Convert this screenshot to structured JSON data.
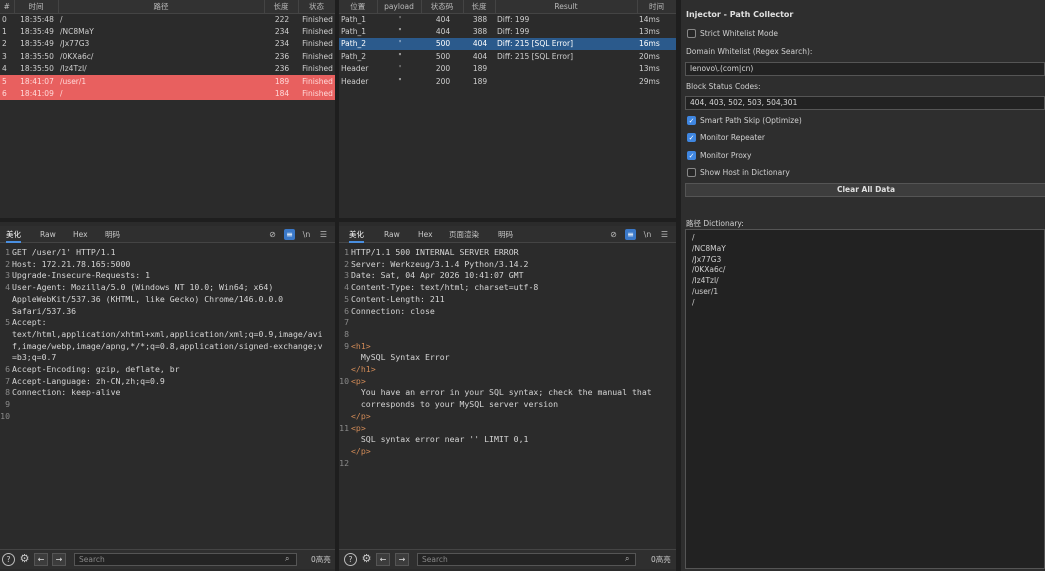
{
  "left_table": {
    "headers": [
      "#",
      "时间",
      "路径",
      "长度",
      "状态"
    ],
    "rows": [
      {
        "id": "0",
        "time": "18:35:48",
        "path": "/",
        "length": "222",
        "status": "Finished",
        "style": "normal"
      },
      {
        "id": "1",
        "time": "18:35:49",
        "path": "/NC8MaY",
        "length": "234",
        "status": "Finished",
        "style": "normal"
      },
      {
        "id": "2",
        "time": "18:35:49",
        "path": "/Jx77G3",
        "length": "234",
        "status": "Finished",
        "style": "normal"
      },
      {
        "id": "3",
        "time": "18:35:50",
        "path": "/0KXa6c/",
        "length": "236",
        "status": "Finished",
        "style": "normal"
      },
      {
        "id": "4",
        "time": "18:35:50",
        "path": "/Iz4TzI/",
        "length": "236",
        "status": "Finished",
        "style": "normal"
      },
      {
        "id": "5",
        "time": "18:41:07",
        "path": "/user/1",
        "length": "189",
        "status": "Finished",
        "style": "red"
      },
      {
        "id": "6",
        "time": "18:41:09",
        "path": "/",
        "length": "184",
        "status": "Finished",
        "style": "red"
      }
    ]
  },
  "mid_table": {
    "headers": [
      "位置",
      "payload",
      "状态码",
      "长度",
      "Result",
      "时间"
    ],
    "rows": [
      {
        "pos": "Path_1",
        "payload": "'",
        "code": "404",
        "length": "388",
        "result": "Diff: 199",
        "time": "14ms",
        "style": "normal"
      },
      {
        "pos": "Path_1",
        "payload": "\"",
        "code": "404",
        "length": "388",
        "result": "Diff: 199",
        "time": "13ms",
        "style": "normal"
      },
      {
        "pos": "Path_2",
        "payload": "'",
        "code": "500",
        "length": "404",
        "result": "Diff: 215 [SQL Error]",
        "time": "16ms",
        "style": "selected"
      },
      {
        "pos": "Path_2",
        "payload": "\"",
        "code": "500",
        "length": "404",
        "result": "Diff: 215 [SQL Error]",
        "time": "20ms",
        "style": "normal"
      },
      {
        "pos": "Header",
        "payload": "'",
        "code": "200",
        "length": "189",
        "result": "",
        "time": "13ms",
        "style": "normal"
      },
      {
        "pos": "Header",
        "payload": "\"",
        "code": "200",
        "length": "189",
        "result": "",
        "time": "29ms",
        "style": "normal"
      }
    ]
  },
  "request_editor": {
    "tabs": [
      "美化",
      "Raw",
      "Hex",
      "明码"
    ],
    "lines": [
      {
        "n": "1",
        "t": "GET /user/1' HTTP/1.1"
      },
      {
        "n": "2",
        "t": "Host: 172.21.78.165:5000"
      },
      {
        "n": "3",
        "t": "Upgrade-Insecure-Requests: 1"
      },
      {
        "n": "4",
        "t": "User-Agent: Mozilla/5.0 (Windows NT 10.0; Win64; x64)"
      },
      {
        "n": "",
        "t": "AppleWebKit/537.36 (KHTML, like Gecko) Chrome/146.0.0.0"
      },
      {
        "n": "",
        "t": "Safari/537.36"
      },
      {
        "n": "5",
        "t": "Accept:"
      },
      {
        "n": "",
        "t": "text/html,application/xhtml+xml,application/xml;q=0.9,image/avi"
      },
      {
        "n": "",
        "t": "f,image/webp,image/apng,*/*;q=0.8,application/signed-exchange;v"
      },
      {
        "n": "",
        "t": "=b3;q=0.7"
      },
      {
        "n": "6",
        "t": "Accept-Encoding: gzip, deflate, br"
      },
      {
        "n": "7",
        "t": "Accept-Language: zh-CN,zh;q=0.9"
      },
      {
        "n": "8",
        "t": "Connection: keep-alive"
      },
      {
        "n": "9",
        "t": ""
      },
      {
        "n": "10",
        "t": ""
      }
    ],
    "search_placeholder": "Search",
    "hits": "0高亮"
  },
  "response_editor": {
    "tabs": [
      "美化",
      "Raw",
      "Hex",
      "页面渲染",
      "明码"
    ],
    "lines": [
      {
        "n": "1",
        "t": "HTTP/1.1 500 INTERNAL SERVER ERROR"
      },
      {
        "n": "2",
        "t": "Server: Werkzeug/3.1.4 Python/3.14.2"
      },
      {
        "n": "3",
        "t": "Date: Sat, 04 Apr 2026 10:41:07 GMT"
      },
      {
        "n": "4",
        "t": "Content-Type: text/html; charset=utf-8"
      },
      {
        "n": "5",
        "t": "Content-Length: 211"
      },
      {
        "n": "6",
        "t": "Connection: close"
      },
      {
        "n": "7",
        "t": ""
      },
      {
        "n": "8",
        "t": ""
      },
      {
        "n": "9",
        "t": "<h1>"
      },
      {
        "n": "",
        "t": "  MySQL Syntax Error"
      },
      {
        "n": "",
        "t": "</h1>"
      },
      {
        "n": "10",
        "t": "<p>"
      },
      {
        "n": "",
        "t": "  You have an error in your SQL syntax; check the manual that"
      },
      {
        "n": "",
        "t": "  corresponds to your MySQL server version"
      },
      {
        "n": "",
        "t": "</p>"
      },
      {
        "n": "11",
        "t": "<p>"
      },
      {
        "n": "",
        "t": "  SQL syntax error near '' LIMIT 0,1"
      },
      {
        "n": "",
        "t": "</p>"
      },
      {
        "n": "12",
        "t": ""
      }
    ],
    "search_placeholder": "Search",
    "hits": "0高亮"
  },
  "right_panel": {
    "title": "Injector - Path Collector",
    "strict_whitelist": {
      "label": "Strict Whitelist Mode",
      "checked": false
    },
    "domain_whitelist_label": "Domain Whitelist (Regex Search):",
    "domain_whitelist_value": "lenovo\\.(com|cn)",
    "block_status_label": "Block Status Codes:",
    "block_status_value": "404, 403, 502, 503, 504,301",
    "options": [
      {
        "label": "Smart Path Skip (Optimize)",
        "checked": true
      },
      {
        "label": "Monitor Repeater",
        "checked": true
      },
      {
        "label": "Monitor Proxy",
        "checked": true
      },
      {
        "label": "Show Host in Dictionary",
        "checked": false
      }
    ],
    "clear_button": "Clear All Data",
    "dictionary_label": "路径 Dictionary:",
    "dictionary": [
      "/",
      "/NC8MaY",
      "/Jx77G3",
      "/0KXa6c/",
      "/Iz4TzI/",
      "/user/1",
      "/"
    ]
  },
  "colors": {
    "selected_row": "#2b5a8c",
    "red_row": "#e8605f",
    "accent": "#3f86e0"
  },
  "icons": [
    "help-icon",
    "settings-icon",
    "back-arrow-icon",
    "forward-arrow-icon",
    "search-icon",
    "wrap-icon",
    "newline-icon",
    "menu-icon"
  ]
}
